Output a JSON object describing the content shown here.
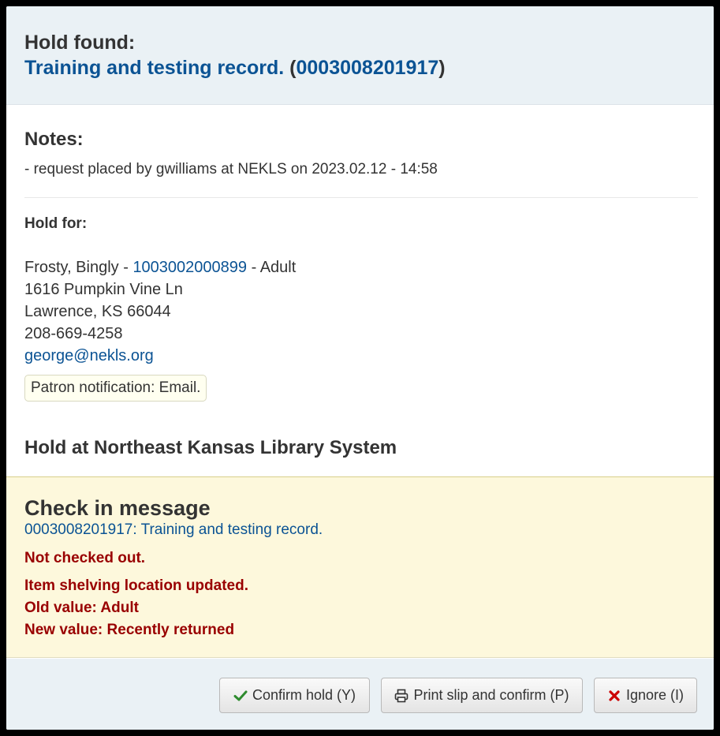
{
  "header": {
    "title": "Hold found:",
    "record_title": "Training and testing record.",
    "barcode": "0003008201917",
    "paren_open": "(",
    "paren_close": ")"
  },
  "notes": {
    "heading": "Notes:",
    "text": "- request placed by gwilliams at NEKLS on 2023.02.12 - 14:58"
  },
  "hold_for": {
    "heading": "Hold for:",
    "name": "Frosty, Bingly - ",
    "card_number": "1003002000899",
    "category": " - Adult",
    "address1": "1616 Pumpkin Vine Ln",
    "address2": "Lawrence, KS 66044",
    "phone": "208-669-4258",
    "email": "george@nekls.org",
    "notification": "Patron notification: Email."
  },
  "hold_at": "Hold at Northeast Kansas Library System",
  "checkin": {
    "heading": "Check in message",
    "item_link": "0003008201917: Training and testing record.",
    "not_checked_out": "Not checked out.",
    "location_updated": "Item shelving location updated.",
    "old_value": "Old value: Adult",
    "new_value": "New value: Recently returned"
  },
  "buttons": {
    "confirm": "Confirm hold (Y)",
    "print": "Print slip and confirm (P)",
    "ignore": "Ignore (I)"
  },
  "colors": {
    "link": "#0b5394",
    "warning": "#990000",
    "checkin_bg": "#fdf8dc",
    "header_bg": "#eaf1f5",
    "check_icon": "#2e8b2e",
    "x_icon": "#cc0000"
  },
  "icons": {
    "confirm": "check-icon",
    "print": "print-icon",
    "ignore": "close-icon"
  }
}
